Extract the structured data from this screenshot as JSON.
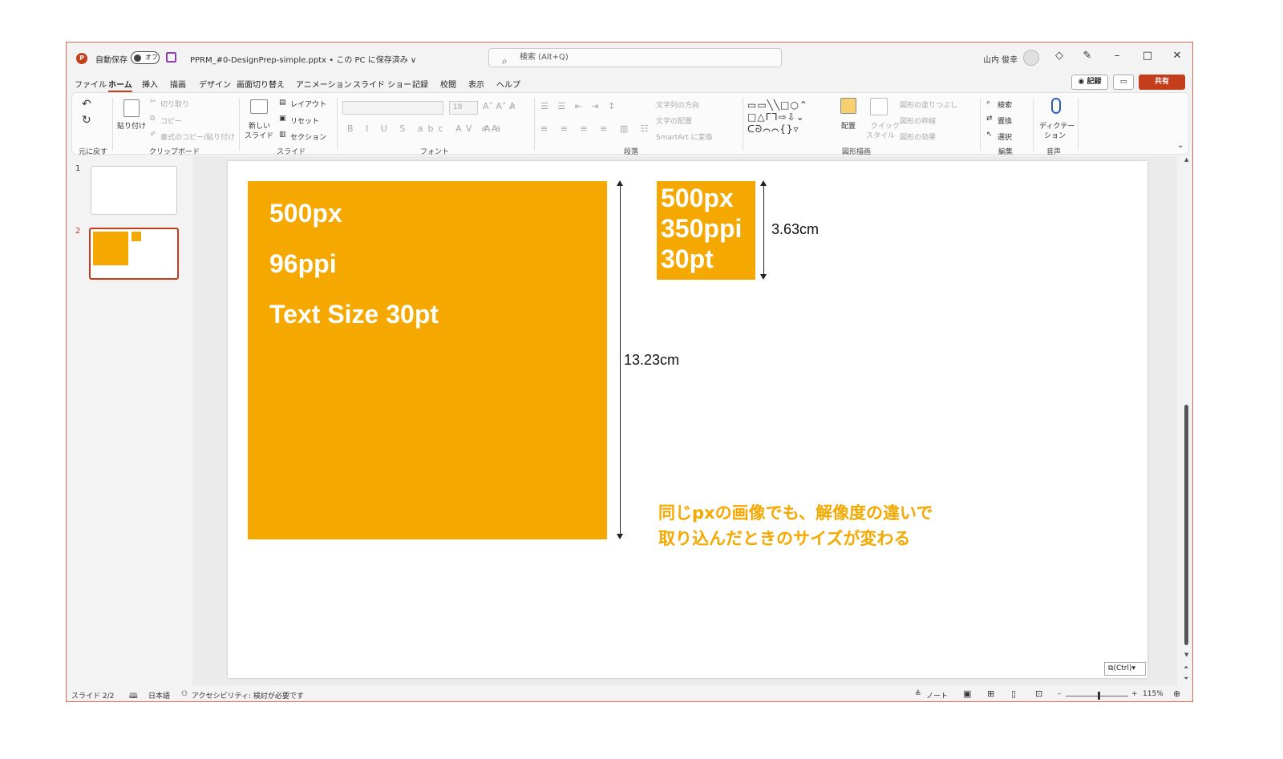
{
  "titlebar": {
    "app_logo": "P",
    "autosave_label": "自動保存",
    "autosave_state": "オフ",
    "document_title": "PPRM_#0-DesignPrep-simple.pptx • この PC に保存済み ∨",
    "search_placeholder": "検索 (Alt+Q)",
    "user_name": "山内 俊幸",
    "icons": [
      "diamond-icon",
      "pen-icon",
      "minimize-icon",
      "maximize-icon",
      "close-icon"
    ]
  },
  "menu": {
    "tabs": [
      "ファイル",
      "ホーム",
      "挿入",
      "描画",
      "デザイン",
      "画面切り替え",
      "アニメーション",
      "スライド ショー",
      "記録",
      "校閲",
      "表示",
      "ヘルプ"
    ],
    "active_tab": "ホーム",
    "record_label": "◉ 記録",
    "comment_label": "▭",
    "share_label": "共有"
  },
  "ribbon": {
    "undo_group": "元に戻す",
    "clipboard": {
      "paste": "貼り付け",
      "cut": "切り取り",
      "copy": "コピー",
      "format_painter": "書式のコピー/貼り付け",
      "label": "クリップボード"
    },
    "slides": {
      "new_slide": "新しい",
      "new_slide_2": "スライド",
      "layout": "レイアウト",
      "reset": "リセット",
      "section": "セクション",
      "label": "スライド"
    },
    "font": {
      "size": "18",
      "label": "フォント"
    },
    "paragraph": {
      "text_direction": "文字列の方向",
      "align_text": "文字の配置",
      "smartart": "SmartArt に変換",
      "label": "段落"
    },
    "drawing": {
      "arrange": "配置",
      "quick_style": "クイック",
      "quick_style_2": "スタイル",
      "fill": "図形の塗りつぶし",
      "outline": "図形の枠線",
      "effect": "図形の効果",
      "label": "図形描画"
    },
    "editing": {
      "find": "検索",
      "replace": "置換",
      "select": "選択",
      "label": "編集"
    },
    "voice": {
      "dictate": "ディクテー",
      "dictate_2": "ション",
      "label": "音声"
    }
  },
  "slides_panel": {
    "items": [
      {
        "number": "1"
      },
      {
        "number": "2"
      }
    ]
  },
  "slide": {
    "big_box": {
      "line1": "500px",
      "line2": "96ppi",
      "line3": "Text Size 30pt"
    },
    "big_height_label": "13.23cm",
    "small_box": {
      "line1": "500px",
      "line2": "350ppi",
      "line3": "30pt"
    },
    "small_height_label": "3.63cm",
    "note_line1": "同じpxの画像でも、解像度の違いで",
    "note_line2": "取り込んだときのサイズが変わる",
    "paste_options": "(Ctrl)",
    "accent_color": "#f5a900"
  },
  "status": {
    "slide_position": "スライド 2/2",
    "language": "日本語",
    "accessibility": "アクセシビリティ: 検討が必要です",
    "notes": "ノート",
    "zoom": "115%"
  }
}
